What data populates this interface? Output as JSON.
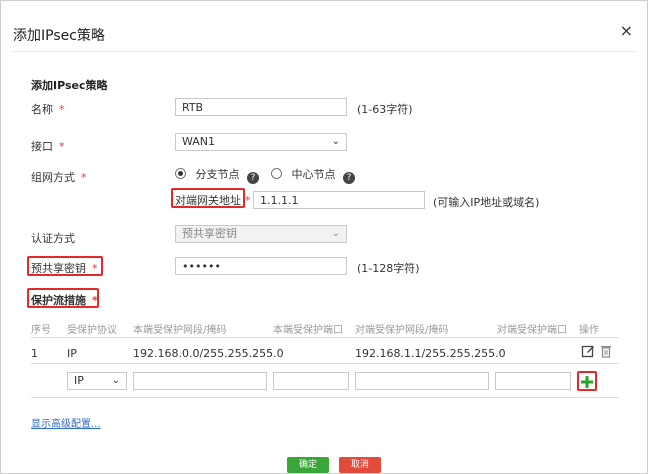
{
  "dialog": {
    "title": "添加IPsec策略",
    "close": "×"
  },
  "section_title": "添加IPsec策略",
  "name": {
    "label": "名称",
    "required": "*",
    "value": "RTB",
    "hint": "(1-63字符)"
  },
  "interface": {
    "label": "接口",
    "required": "*",
    "value": "WAN1"
  },
  "network_mode": {
    "label": "组网方式",
    "required": "*",
    "option_branch": "分支节点",
    "option_center": "中心节点",
    "help": "?"
  },
  "peer_gateway": {
    "label": "对端网关地址",
    "required": "*",
    "value": "1.1.1.1",
    "hint": "(可输入IP地址或域名)"
  },
  "auth": {
    "label": "认证方式",
    "value": "预共享密钥"
  },
  "psk": {
    "label": "预共享密钥",
    "required": "*",
    "value": "••••••",
    "hint": "(1-128字符)"
  },
  "protect": {
    "label": "保护流措施",
    "required": "*"
  },
  "table": {
    "headers": [
      "序号",
      "受保护协议",
      "本端受保护网段/掩码",
      "本端受保护端口",
      "对端受保护网段/掩码",
      "对端受保护端口",
      "操作"
    ],
    "row": {
      "index": "1",
      "protocol": "IP",
      "local_net": "192.168.0.0/255.255.255.0",
      "peer_net": "192.168.1.1/255.255.255.0"
    },
    "new_row_protocol": "IP"
  },
  "advanced_link": "显示高级配置...",
  "buttons": {
    "ok": "确定",
    "cancel": "取消"
  },
  "colors": {
    "highlight": "#e32a2a",
    "add": "#29a329",
    "ok": "#3aa63a",
    "cancel": "#e24a3a"
  }
}
